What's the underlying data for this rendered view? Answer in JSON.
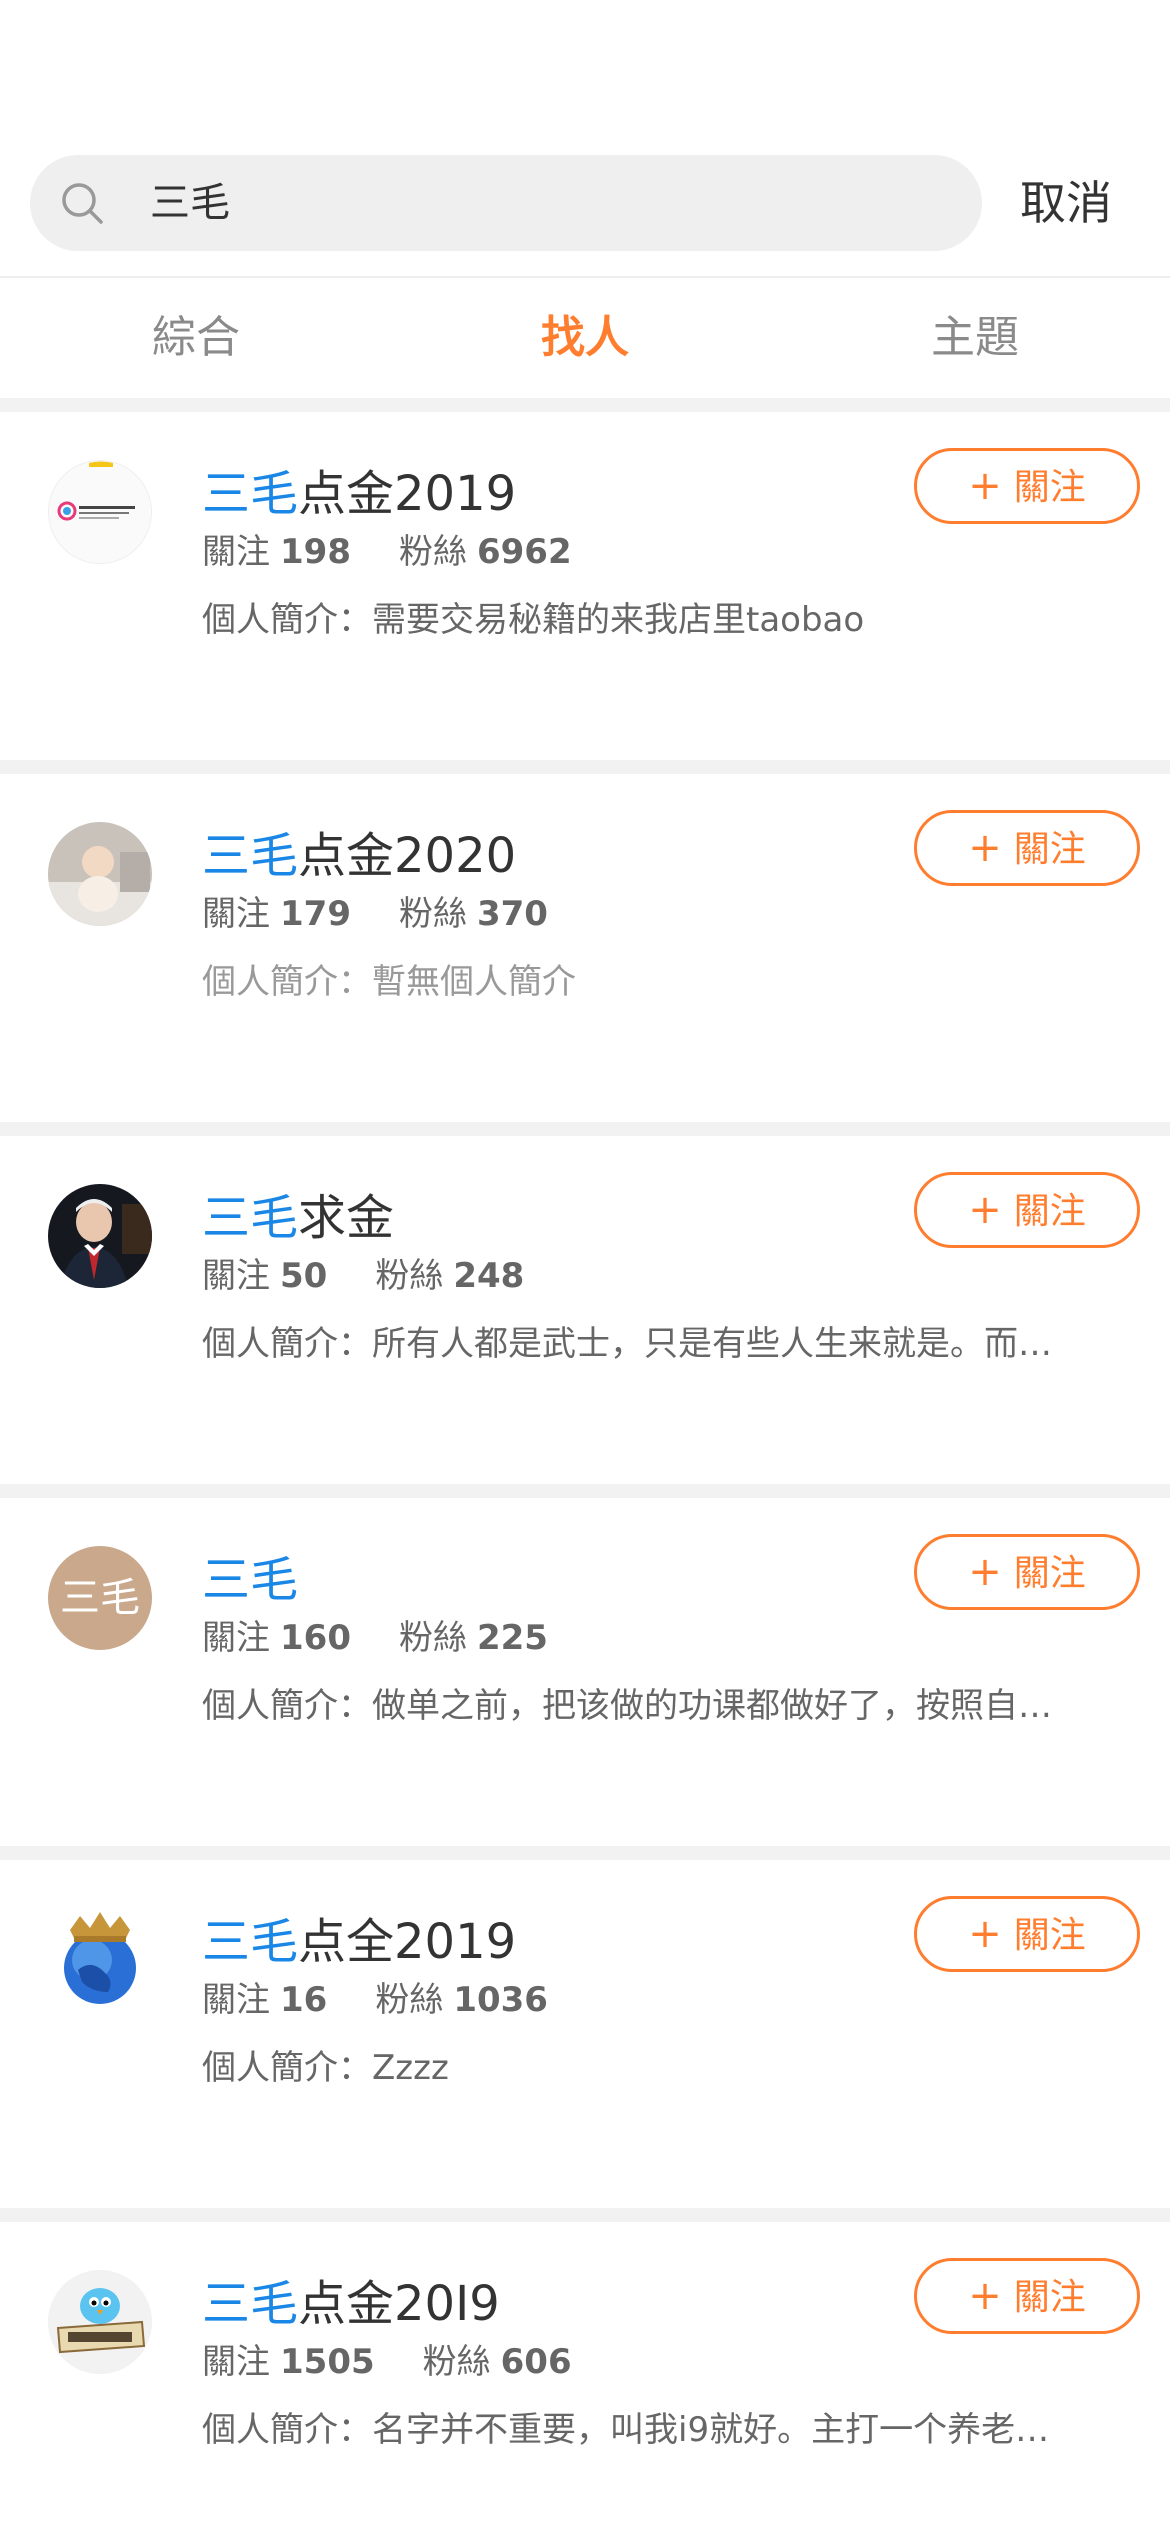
{
  "search": {
    "query": "三毛",
    "cancel_label": "取消"
  },
  "tabs": [
    {
      "label": "綜合",
      "active": false
    },
    {
      "label": "找人",
      "active": true
    },
    {
      "label": "主題",
      "active": false
    }
  ],
  "labels": {
    "follows": "關注",
    "fans": "粉絲",
    "bio_prefix": "個人簡介：",
    "follow_button": "關注",
    "follow_plus": "+"
  },
  "colors": {
    "accent": "#ff7d2e",
    "highlight": "#1a87e6"
  },
  "users": [
    {
      "name_highlight": "三毛",
      "name_rest": "点金2019",
      "follows": "198",
      "fans": "6962",
      "bio": "需要交易秘籍的来我店里taobao",
      "bio_muted": false,
      "avatar": "logo-avatar"
    },
    {
      "name_highlight": "三毛",
      "name_rest": "点金2020",
      "follows": "179",
      "fans": "370",
      "bio": "暫無個人簡介",
      "bio_muted": true,
      "avatar": "baby-photo-avatar"
    },
    {
      "name_highlight": "三毛",
      "name_rest": "求金",
      "follows": "50",
      "fans": "248",
      "bio": "所有人都是武士，只是有些人生来就是。而…",
      "bio_muted": false,
      "avatar": "man-photo-avatar"
    },
    {
      "name_highlight": "三毛",
      "name_rest": "",
      "follows": "160",
      "fans": "225",
      "bio": "做单之前，把该做的功课都做好了，按照自…",
      "bio_muted": false,
      "avatar": "text-avatar",
      "avatar_text": "三毛"
    },
    {
      "name_highlight": "三毛",
      "name_rest": "点全2019",
      "follows": "16",
      "fans": "1036",
      "bio": "Zzzz",
      "bio_muted": false,
      "avatar": "globe-crown-avatar"
    },
    {
      "name_highlight": "三毛",
      "name_rest": "点金20I9",
      "follows": "1505",
      "fans": "606",
      "bio": "名字并不重要，叫我i9就好。主打一个养老…",
      "bio_muted": false,
      "avatar": "twitter-bird-avatar"
    }
  ]
}
